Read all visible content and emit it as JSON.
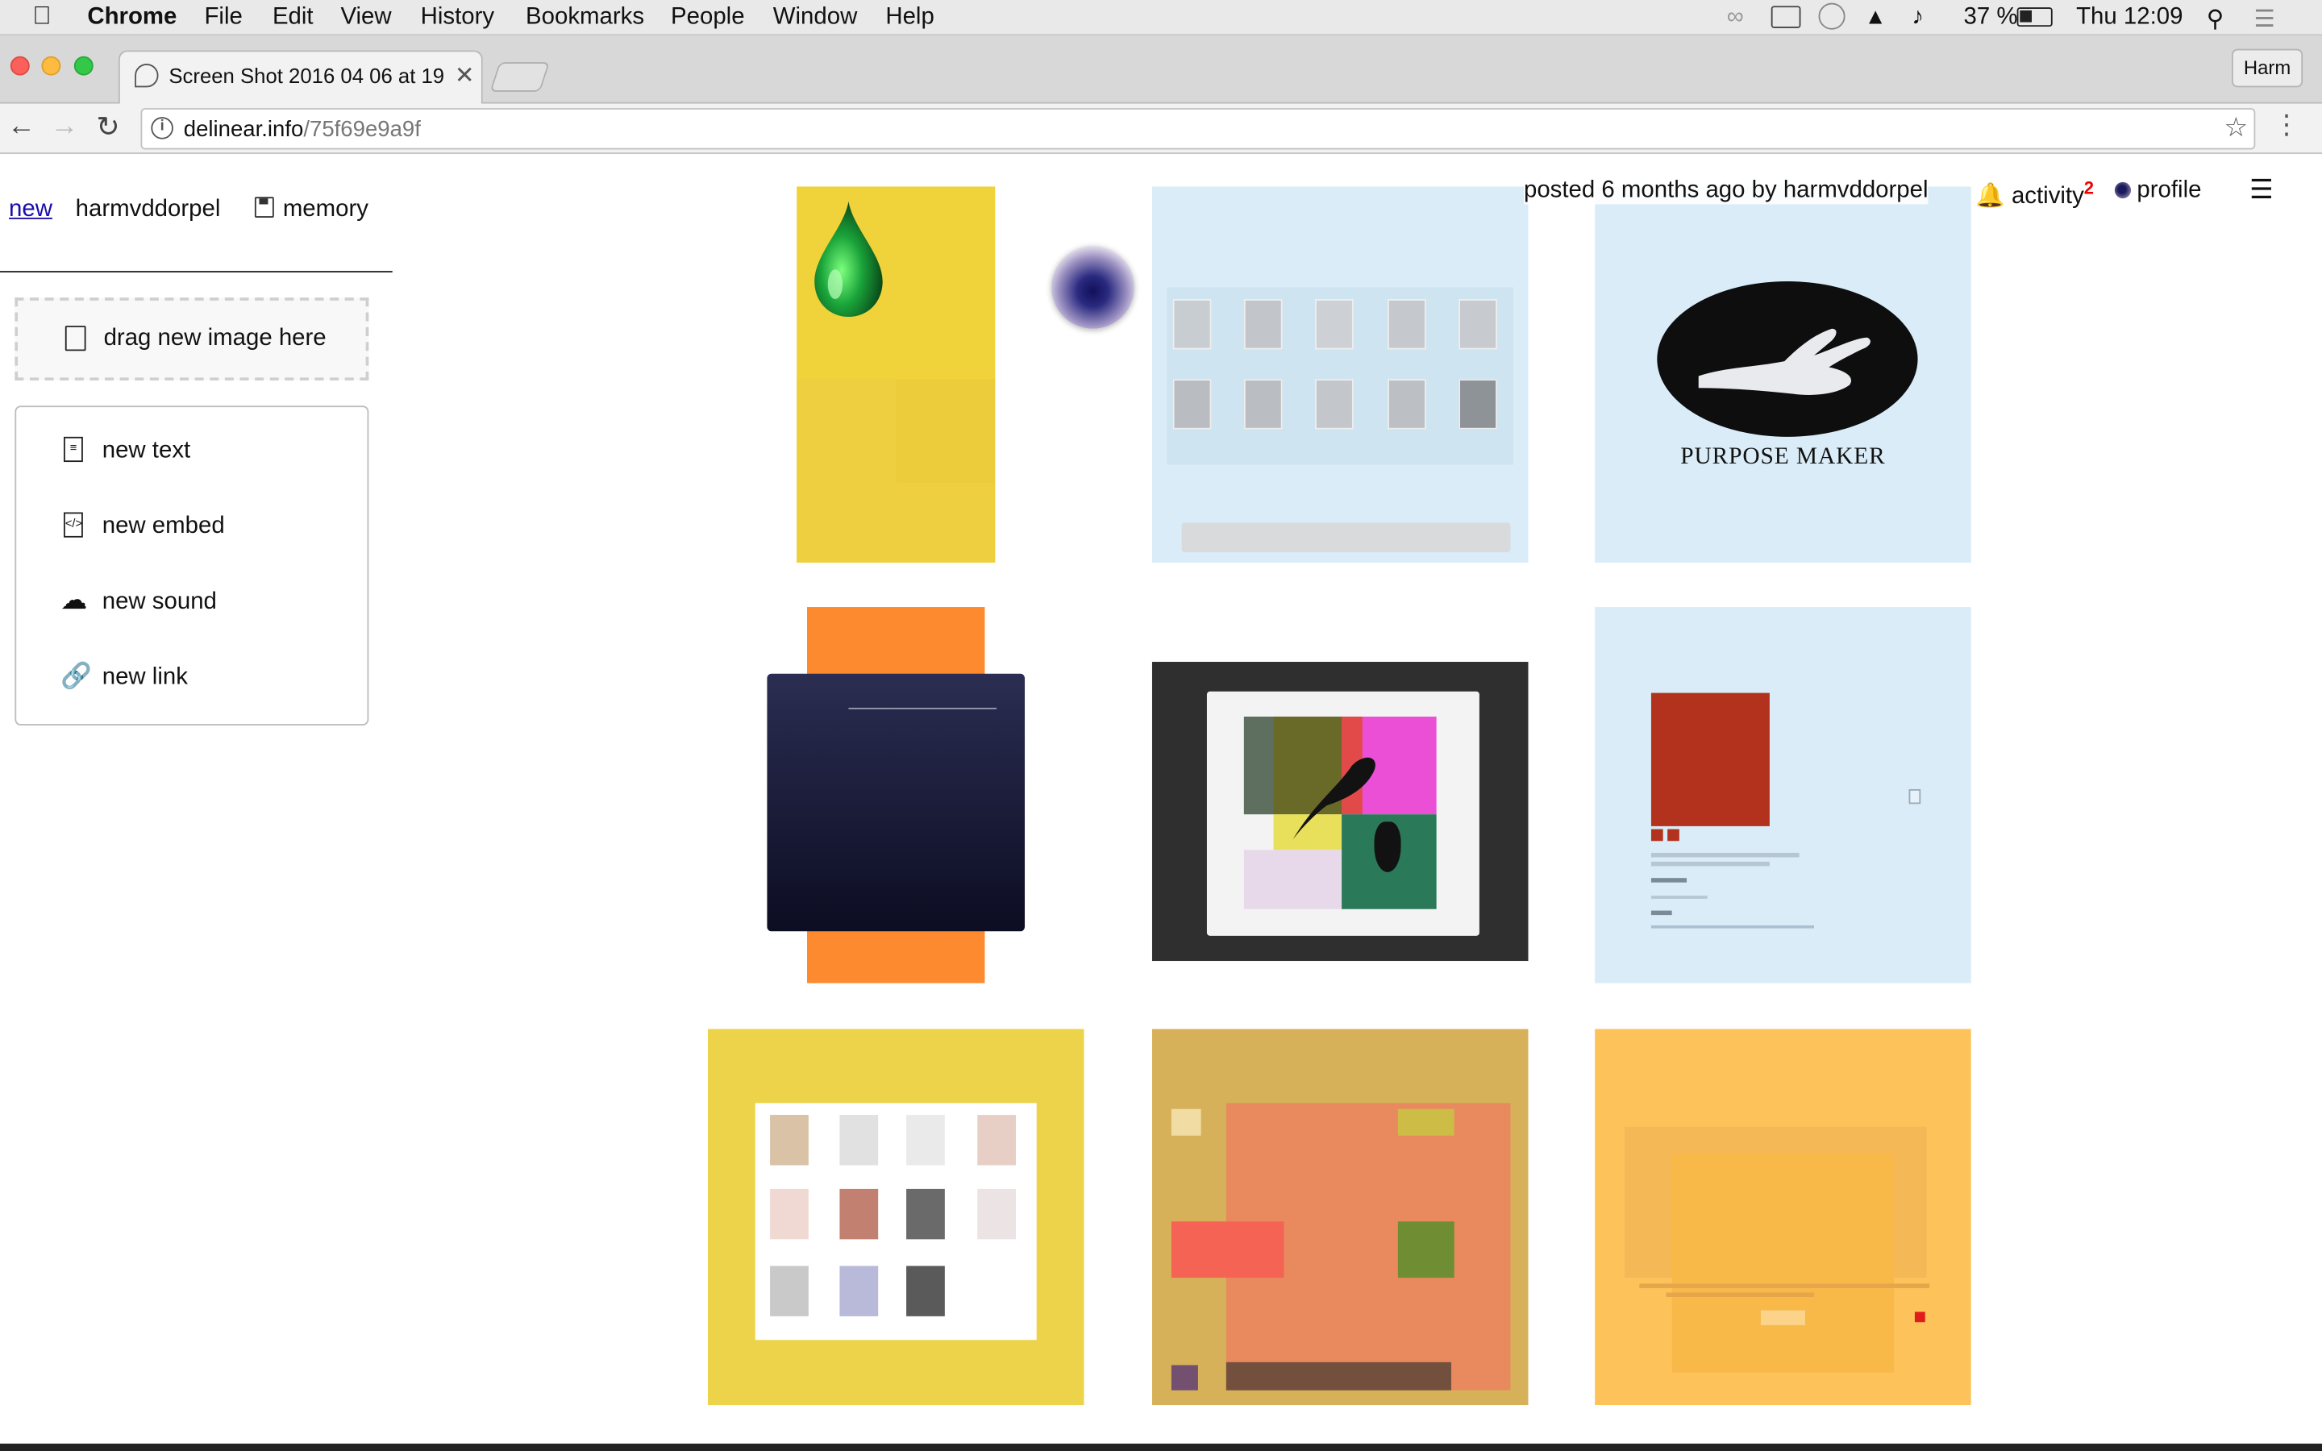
{
  "menubar": {
    "app": "Chrome",
    "items": [
      "File",
      "Edit",
      "View",
      "History",
      "Bookmarks",
      "People",
      "Window",
      "Help"
    ],
    "battery": "37 %",
    "clock": "Thu 12:09"
  },
  "browser": {
    "tab_title": "Screen Shot 2016 04 06 at 19",
    "profile_button": "Harm",
    "url_host": "delinear.info",
    "url_path": "/75f69e9a9f"
  },
  "nav": {
    "new": "new",
    "user": "harmvddorpel",
    "memory": "memory"
  },
  "drop": {
    "label": "drag new image here"
  },
  "create_menu": [
    {
      "icon": "text-file-icon",
      "label": "new text"
    },
    {
      "icon": "code-file-icon",
      "label": "new embed"
    },
    {
      "icon": "soundcloud-icon",
      "label": "new sound"
    },
    {
      "icon": "link-icon",
      "label": "new link"
    }
  ],
  "header": {
    "posted": "posted 6 months ago by harmvddorpel",
    "activity": "activity",
    "activity_count": "2",
    "profile": "profile"
  },
  "tiles": {
    "purpose_maker": "PURPOSE MAKER"
  },
  "colors": {
    "link_blue": "#1a0dab",
    "yellow": "#f0d23a",
    "orange": "#fd8a2e",
    "navy": "#1b1c36",
    "salmon": "#e88a5e",
    "light_blue": "#d9ecf7"
  }
}
